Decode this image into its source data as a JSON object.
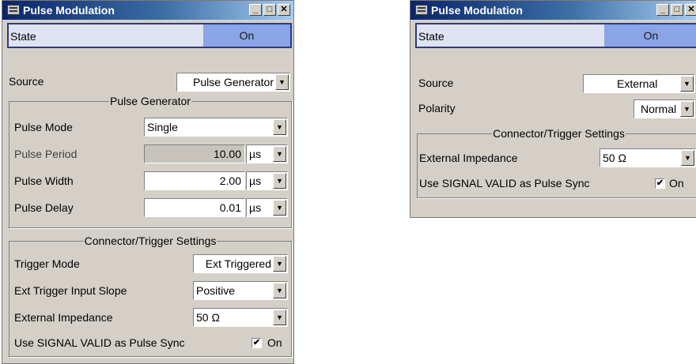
{
  "left": {
    "title": "Pulse Modulation",
    "state": {
      "label": "State",
      "value": "On"
    },
    "source": {
      "label": "Source",
      "value": "Pulse Generator"
    },
    "pulse_group": {
      "title": "Pulse Generator",
      "mode": {
        "label": "Pulse Mode",
        "value": "Single"
      },
      "period": {
        "label": "Pulse Period",
        "value": "10.00",
        "unit": "µs"
      },
      "width": {
        "label": "Pulse Width",
        "value": "2.00",
        "unit": "µs"
      },
      "delay": {
        "label": "Pulse Delay",
        "value": "0.01",
        "unit": "µs"
      }
    },
    "trigger_group": {
      "title": "Connector/Trigger Settings",
      "trigger_mode": {
        "label": "Trigger Mode",
        "value": "Ext Triggered"
      },
      "slope": {
        "label": "Ext Trigger Input Slope",
        "value": "Positive"
      },
      "impedance": {
        "label": "External Impedance",
        "value": "50 Ω"
      },
      "signal_valid": {
        "label": "Use SIGNAL VALID as Pulse Sync",
        "value": "On",
        "checked": true
      }
    }
  },
  "right": {
    "title": "Pulse Modulation",
    "state": {
      "label": "State",
      "value": "On"
    },
    "source": {
      "label": "Source",
      "value": "External"
    },
    "polarity": {
      "label": "Polarity",
      "value": "Normal"
    },
    "trigger_group": {
      "title": "Connector/Trigger Settings",
      "impedance": {
        "label": "External Impedance",
        "value": "50 Ω"
      },
      "signal_valid": {
        "label": "Use SIGNAL VALID as Pulse Sync",
        "value": "On",
        "checked": true
      }
    }
  },
  "icons": {
    "minimize": "_",
    "maximize": "□",
    "close": "✕",
    "dropdown": "▼",
    "check": "✔"
  }
}
